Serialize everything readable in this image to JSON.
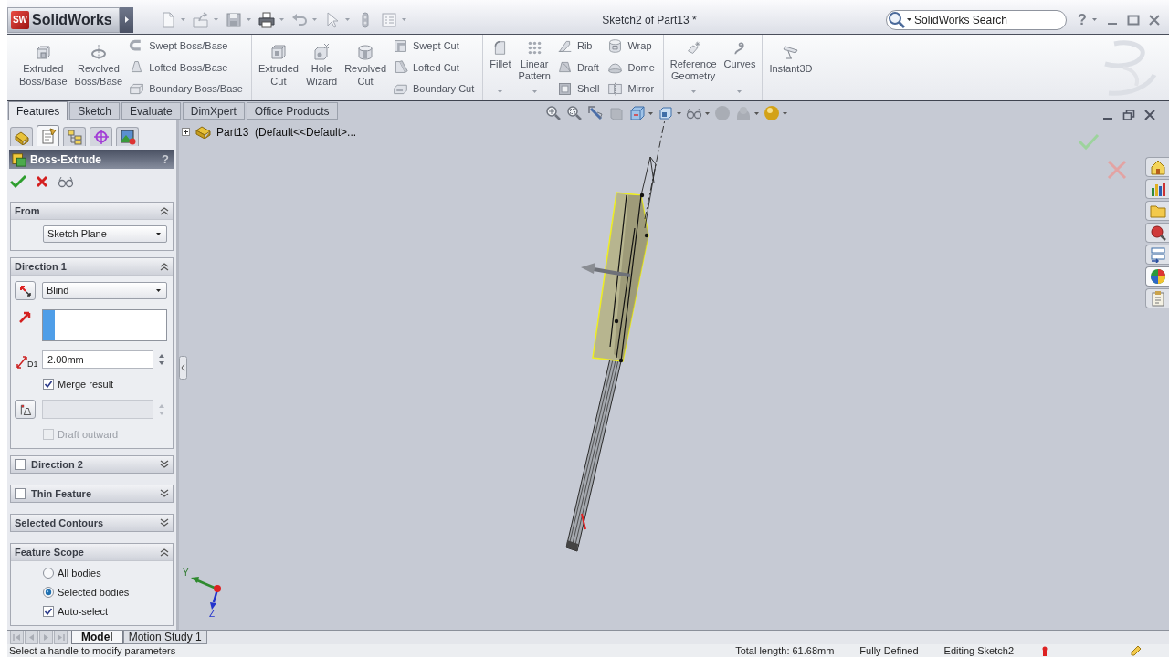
{
  "title_bar": {
    "logo_badge": "SW",
    "app_name": "SolidWorks",
    "document_title": "Sketch2 of Part13 *",
    "search": {
      "placeholder": "SolidWorks Search"
    },
    "help": "?"
  },
  "ribbon": {
    "groups": [
      {
        "items": [
          {
            "kind": "large",
            "label": "Extruded Boss/Base"
          },
          {
            "kind": "large",
            "label": "Revolved Boss/Base"
          },
          {
            "kind": "stack",
            "items": [
              {
                "label": "Swept Boss/Base"
              },
              {
                "label": "Lofted Boss/Base"
              },
              {
                "label": "Boundary Boss/Base"
              }
            ]
          }
        ]
      },
      {
        "items": [
          {
            "kind": "large",
            "label": "Extruded Cut"
          },
          {
            "kind": "large",
            "label": "Hole Wizard"
          },
          {
            "kind": "large",
            "label": "Revolved Cut"
          },
          {
            "kind": "stack",
            "items": [
              {
                "label": "Swept Cut"
              },
              {
                "label": "Lofted Cut"
              },
              {
                "label": "Boundary Cut"
              }
            ]
          }
        ]
      },
      {
        "items": [
          {
            "kind": "menu",
            "label": "Fillet"
          },
          {
            "kind": "menu",
            "label": "Linear Pattern"
          },
          {
            "kind": "stack",
            "items": [
              {
                "label": "Rib"
              },
              {
                "label": "Draft"
              },
              {
                "label": "Shell"
              }
            ]
          },
          {
            "kind": "stack",
            "items": [
              {
                "label": "Wrap"
              },
              {
                "label": "Dome"
              },
              {
                "label": "Mirror"
              }
            ]
          }
        ]
      },
      {
        "items": [
          {
            "kind": "menu",
            "label": "Reference Geometry"
          },
          {
            "kind": "menu",
            "label": "Curves"
          }
        ]
      },
      {
        "items": [
          {
            "kind": "large",
            "label": "Instant3D"
          }
        ]
      }
    ]
  },
  "command_tabs": [
    {
      "label": "Features",
      "selected": true
    },
    {
      "label": "Sketch",
      "selected": false
    },
    {
      "label": "Evaluate",
      "selected": false
    },
    {
      "label": "DimXpert",
      "selected": false
    },
    {
      "label": "Office Products",
      "selected": false
    }
  ],
  "panel": {
    "manager_tabs": [
      {
        "selected": false
      },
      {
        "selected": true
      },
      {
        "selected": false
      },
      {
        "selected": false
      },
      {
        "selected": false
      }
    ],
    "title": "Boss-Extrude",
    "help": "?",
    "groups": [
      {
        "title": "From",
        "expanded": true,
        "controls": [
          {
            "kind": "dropdown",
            "value": "Sketch Plane"
          }
        ]
      },
      {
        "title": "Direction 1",
        "expanded": true,
        "controls": [
          {
            "kind": "reverse_dropdown",
            "value": "Blind"
          },
          {
            "kind": "selection_box"
          },
          {
            "kind": "depth_field",
            "icon_label": "D1",
            "value": "2.00mm"
          },
          {
            "kind": "checkbox",
            "label": "Merge result",
            "checked": true,
            "disabled": false
          },
          {
            "kind": "draft_field",
            "disabled": true
          },
          {
            "kind": "checkbox",
            "label": "Draft outward",
            "checked": false,
            "disabled": true
          }
        ]
      },
      {
        "title": "Direction 2",
        "expanded": false,
        "checked": false
      },
      {
        "title": "Thin Feature",
        "expanded": false,
        "checked": false
      },
      {
        "title": "Selected Contours",
        "expanded": false
      },
      {
        "title": "Feature Scope",
        "expanded": true,
        "controls": [
          {
            "kind": "radio",
            "label": "All bodies",
            "selected": false
          },
          {
            "kind": "radio",
            "label": "Selected bodies",
            "selected": true
          },
          {
            "kind": "checkbox",
            "label": "Auto-select",
            "checked": true,
            "disabled": false
          }
        ]
      }
    ]
  },
  "feature_tree": {
    "label": "Part13  (Default<<Default>...",
    "expanded": false
  },
  "task_pane": [
    {
      "selected": false
    },
    {
      "selected": false
    },
    {
      "selected": false
    },
    {
      "selected": false
    },
    {
      "selected": false
    },
    {
      "selected": true
    },
    {
      "selected": false
    }
  ],
  "triad_labels": [
    "Y",
    "Z"
  ],
  "bottom_tabs": [
    {
      "label": "Model",
      "selected": true
    },
    {
      "label": "Motion Study 1",
      "selected": false
    }
  ],
  "status_bar": {
    "message": "Select a handle to modify parameters",
    "fields": [
      "Total length: 61.68mm",
      "Fully Defined",
      "Editing Sketch2"
    ]
  }
}
